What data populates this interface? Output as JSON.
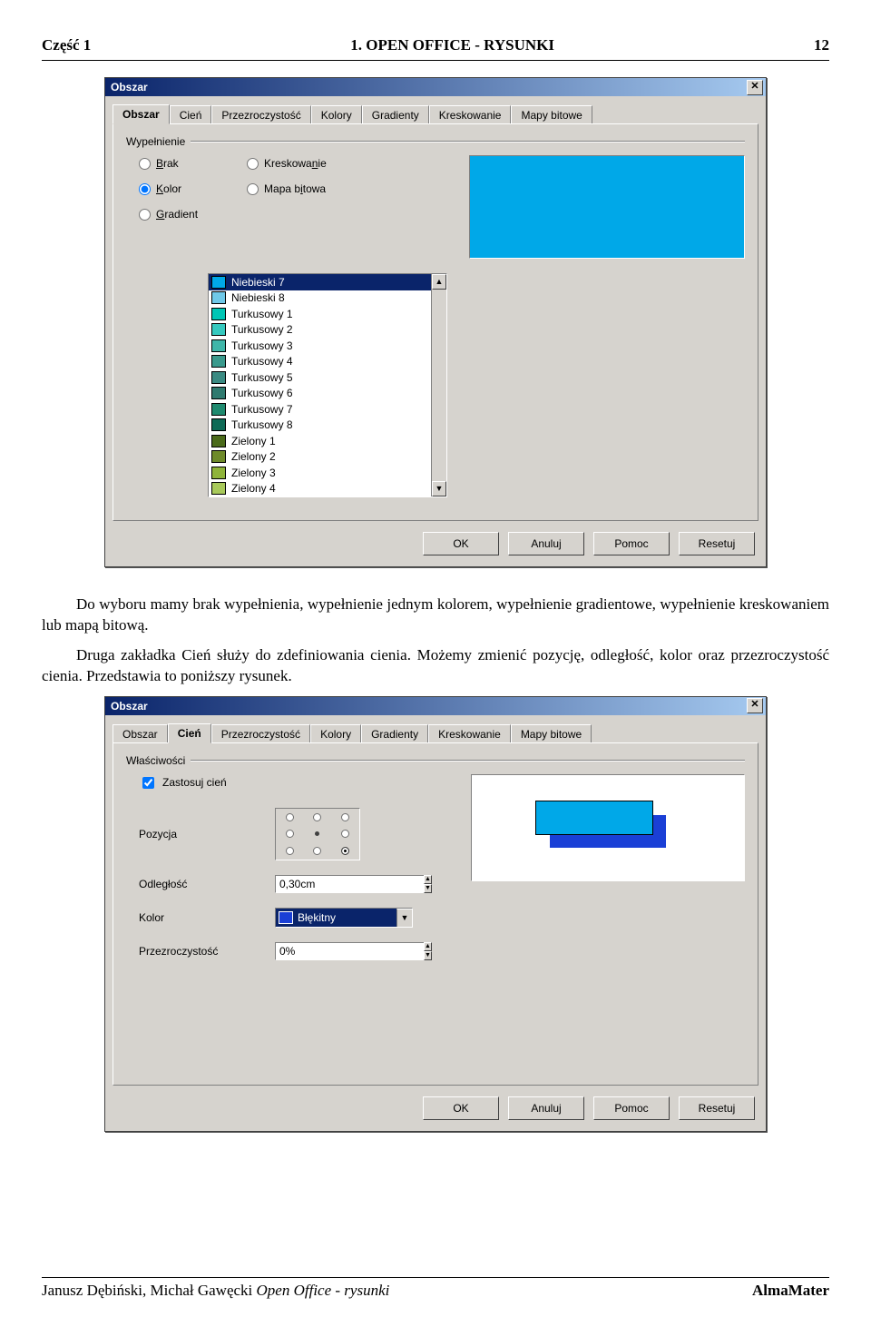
{
  "header": {
    "left": "Część 1",
    "center": "1. OPEN OFFICE - RYSUNKI",
    "right": "12"
  },
  "dialog1": {
    "title": "Obszar",
    "tabs": [
      "Obszar",
      "Cień",
      "Przezroczystość",
      "Kolory",
      "Gradienty",
      "Kreskowanie",
      "Mapy bitowe"
    ],
    "active_tab": "Obszar",
    "group_label": "Wypełnienie",
    "radios_col1": [
      {
        "label": "Brak",
        "u": "B"
      },
      {
        "label": "Kolor",
        "u": "K",
        "selected": true
      },
      {
        "label": "Gradient",
        "u": "G"
      }
    ],
    "radios_col2": [
      {
        "label": "Kreskowanie",
        "u": "n"
      },
      {
        "label": "Mapa bitowa",
        "u": "i"
      }
    ],
    "preview_color": "#00a8e8",
    "colors": [
      {
        "name": "Niebieski 7",
        "hex": "#00a8e8",
        "selected": true
      },
      {
        "name": "Niebieski 8",
        "hex": "#6fc8e8"
      },
      {
        "name": "Turkusowy 1",
        "hex": "#00c6b5"
      },
      {
        "name": "Turkusowy 2",
        "hex": "#35c9bf"
      },
      {
        "name": "Turkusowy 3",
        "hex": "#3fb6a9"
      },
      {
        "name": "Turkusowy 4",
        "hex": "#3a9a8d"
      },
      {
        "name": "Turkusowy 5",
        "hex": "#3a8a82"
      },
      {
        "name": "Turkusowy 6",
        "hex": "#2f7a6f"
      },
      {
        "name": "Turkusowy 7",
        "hex": "#1f8a6f"
      },
      {
        "name": "Turkusowy 8",
        "hex": "#0e6a56"
      },
      {
        "name": "Zielony 1",
        "hex": "#4a6a1a"
      },
      {
        "name": "Zielony 2",
        "hex": "#6e8a2a"
      },
      {
        "name": "Zielony 3",
        "hex": "#8fb43a"
      },
      {
        "name": "Zielony 4",
        "hex": "#a8c95a"
      }
    ],
    "buttons": [
      "OK",
      "Anuluj",
      "Pomoc",
      "Resetuj"
    ]
  },
  "para1": "Do wyboru mamy brak wypełnienia, wypełnienie jednym kolorem, wypełnienie gradientowe, wypełnienie kreskowaniem lub mapą bitową.",
  "para2": "Druga zakładka Cień służy do zdefiniowania cienia. Możemy zmienić pozycję, odległość, kolor oraz przezroczystość cienia. Przedstawia to poniższy rysunek.",
  "dialog2": {
    "title": "Obszar",
    "tabs": [
      "Obszar",
      "Cień",
      "Przezroczystość",
      "Kolory",
      "Gradienty",
      "Kreskowanie",
      "Mapy bitowe"
    ],
    "active_tab": "Cień",
    "group_label": "Właściwości",
    "apply_label": "Zastosuj cień",
    "pos_label": "Pozycja",
    "dist_label": "Odległość",
    "dist_value": "0,30cm",
    "color_label": "Kolor",
    "color_value": "Błękitny",
    "color_hex": "#1a3fd6",
    "trans_label": "Przezroczystość",
    "trans_value": "0%",
    "buttons": [
      "OK",
      "Anuluj",
      "Pomoc",
      "Resetuj"
    ]
  },
  "footer": {
    "authors": "Janusz Dębiński, Michał Gawęcki ",
    "title_ital": "Open Office - rysunki",
    "right": "AlmaMater"
  }
}
